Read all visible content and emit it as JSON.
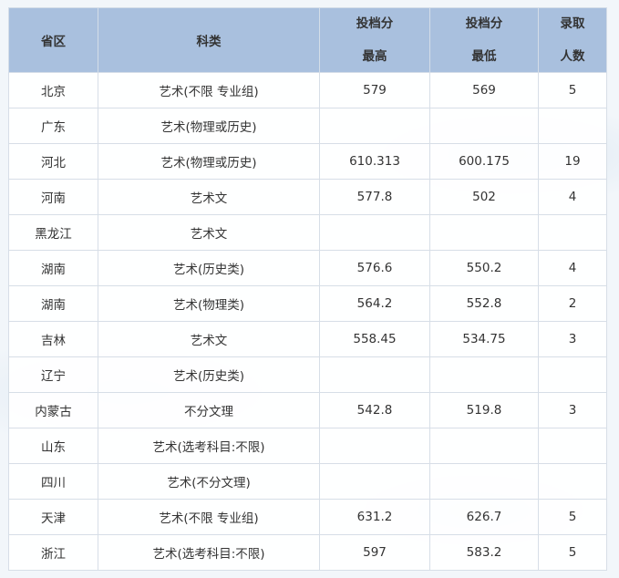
{
  "header": {
    "province": "省区",
    "category": "科类",
    "max_line1": "投档分",
    "max_line2": "最高",
    "min_line1": "投档分",
    "min_line2": "最低",
    "count_line1": "录取",
    "count_line2": "人数"
  },
  "rows": [
    {
      "province": "北京",
      "category": "艺术(不限 专业组)",
      "max": "579",
      "min": "569",
      "count": "5"
    },
    {
      "province": "广东",
      "category": "艺术(物理或历史)",
      "max": "",
      "min": "",
      "count": ""
    },
    {
      "province": "河北",
      "category": "艺术(物理或历史)",
      "max": "610.313",
      "min": "600.175",
      "count": "19"
    },
    {
      "province": "河南",
      "category": "艺术文",
      "max": "577.8",
      "min": "502",
      "count": "4"
    },
    {
      "province": "黑龙江",
      "category": "艺术文",
      "max": "",
      "min": "",
      "count": ""
    },
    {
      "province": "湖南",
      "category": "艺术(历史类)",
      "max": "576.6",
      "min": "550.2",
      "count": "4"
    },
    {
      "province": "湖南",
      "category": "艺术(物理类)",
      "max": "564.2",
      "min": "552.8",
      "count": "2"
    },
    {
      "province": "吉林",
      "category": "艺术文",
      "max": "558.45",
      "min": "534.75",
      "count": "3"
    },
    {
      "province": "辽宁",
      "category": "艺术(历史类)",
      "max": "",
      "min": "",
      "count": ""
    },
    {
      "province": "内蒙古",
      "category": "不分文理",
      "max": "542.8",
      "min": "519.8",
      "count": "3"
    },
    {
      "province": "山东",
      "category": "艺术(选考科目:不限)",
      "max": "",
      "min": "",
      "count": ""
    },
    {
      "province": "四川",
      "category": "艺术(不分文理)",
      "max": "",
      "min": "",
      "count": ""
    },
    {
      "province": "天津",
      "category": "艺术(不限 专业组)",
      "max": "631.2",
      "min": "626.7",
      "count": "5"
    },
    {
      "province": "浙江",
      "category": "艺术(选考科目:不限)",
      "max": "597",
      "min": "583.2",
      "count": "5"
    }
  ]
}
